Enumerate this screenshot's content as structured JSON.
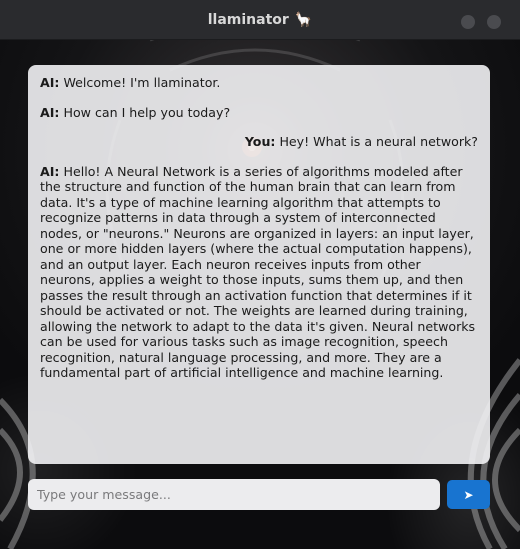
{
  "window": {
    "title": "llaminator",
    "title_icon": "🦙"
  },
  "messages": [
    {
      "role": "ai",
      "sender": "AI:",
      "text": " Welcome! I'm llaminator."
    },
    {
      "role": "ai",
      "sender": "AI:",
      "text": " How can I help you today?"
    },
    {
      "role": "user",
      "sender": "You:",
      "text": " Hey! What is a neural network?"
    },
    {
      "role": "ai",
      "sender": "AI:",
      "text": " Hello! A Neural Network is a series of algorithms modeled after the structure and function of the human brain that can learn from data. It's a type of machine learning algorithm that attempts to recognize patterns in data through a system of interconnected nodes, or \"neurons.\" Neurons are organized in layers: an input layer, one or more hidden layers (where the actual computation happens), and an output layer. Each neuron receives inputs from other neurons, applies a weight to those inputs, sums them up, and then passes the result through an activation function that determines if it should be activated or not. The weights are learned during training, allowing the network to adapt to the data it's given. Neural networks can be used for various tasks such as image recognition, speech recognition, natural language processing, and more. They are a fundamental part of artificial intelligence and machine learning."
    }
  ],
  "composer": {
    "placeholder": "Type your message...",
    "value": "",
    "send_label": "➤"
  },
  "colors": {
    "accent": "#1874d0",
    "titlebar": "#2a2b2e",
    "panel": "#f2f2f4"
  }
}
